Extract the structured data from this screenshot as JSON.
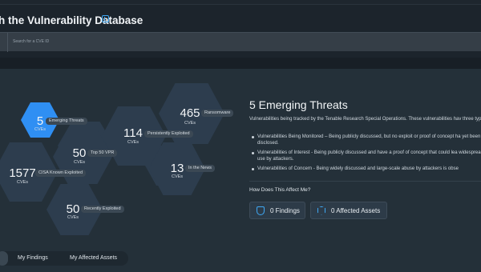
{
  "search": {
    "title": "h the Vulnerability Database",
    "placeholder": "Search for a CVE ID"
  },
  "hexmap": {
    "unit": "CVEs",
    "items": [
      {
        "id": "emerging",
        "count": "5",
        "label": "Emerging Threats",
        "active": true
      },
      {
        "id": "ransomware",
        "count": "465",
        "label": "Ransomware",
        "active": false
      },
      {
        "id": "persistent",
        "count": "114",
        "label": "Persistently Exploited",
        "active": false
      },
      {
        "id": "top50",
        "count": "50",
        "label": "Top 50 VPR",
        "active": false
      },
      {
        "id": "cisa",
        "count": "1577",
        "label": "CISA Known Exploited",
        "active": false
      },
      {
        "id": "news",
        "count": "13",
        "label": "In the News",
        "active": false
      },
      {
        "id": "recent",
        "count": "50",
        "label": "Recently Exploited",
        "active": false
      }
    ]
  },
  "tabs": {
    "items": [
      "My Findings",
      "My Affected Assets"
    ]
  },
  "details": {
    "title": "5 Emerging Threats",
    "description": "Vulnerabilities being tracked by the Tenable Research Special Operations. These vulnerabilities hav three types:",
    "bullets": [
      "Vulnerabilities Being Monitored – Being publicly discussed, but no exploit or proof of concept ha yet been disclosed.",
      "Vulnerabilities of Interest - Being publicly discussed and have a proof of concept that could lea widespread use by attackers.",
      "Vulnerabilities of Concern - Being widely discussed and large-scale abuse by attackers is obse"
    ],
    "question": "How Does This Affect Me?",
    "findings_button": "0 Findings",
    "assets_button": "0 Affected Assets"
  },
  "colors": {
    "accent": "#2f8ff3",
    "hex": "#2d3d4e",
    "panel": "#243039",
    "background": "#1a2128"
  },
  "icons": {
    "info": "info-icon",
    "findings": "shield-icon",
    "assets": "cube-icon"
  }
}
